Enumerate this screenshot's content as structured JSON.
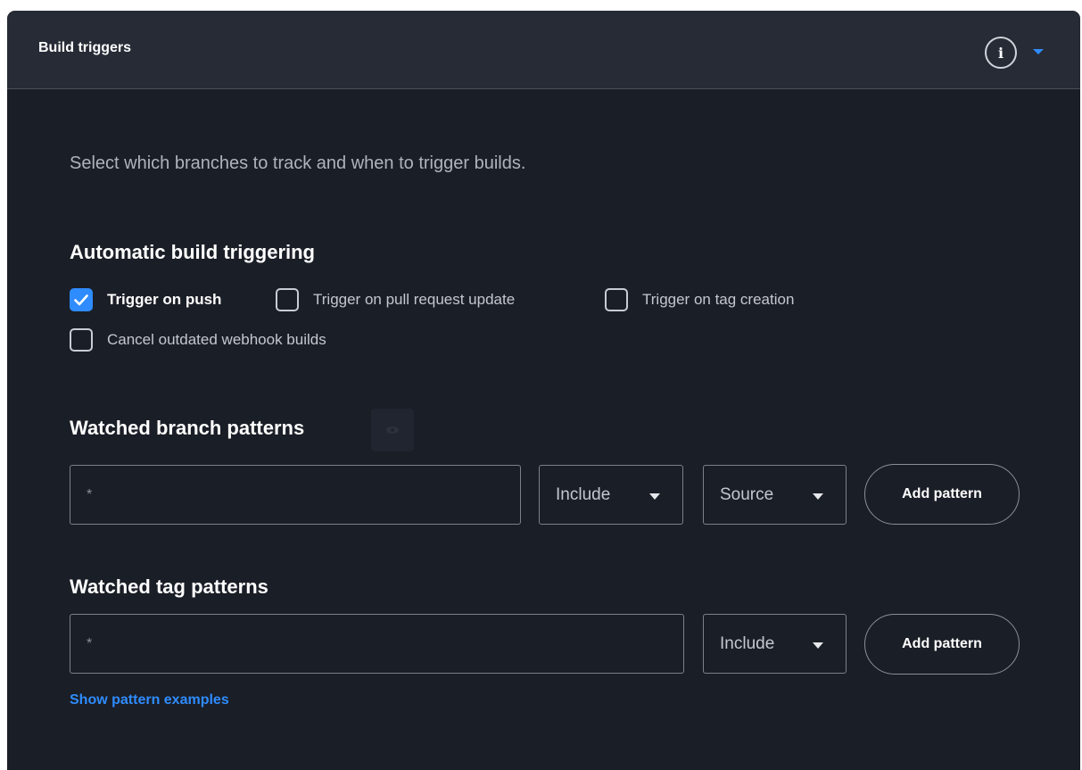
{
  "header": {
    "title": "Build triggers",
    "info_label": "i"
  },
  "intro": "Select which branches to track and when to trigger builds.",
  "automatic": {
    "title": "Automatic build triggering",
    "options": [
      {
        "label": "Trigger on push",
        "checked": true
      },
      {
        "label": "Trigger on pull request update",
        "checked": false
      },
      {
        "label": "Trigger on tag creation",
        "checked": false
      },
      {
        "label": "Cancel outdated webhook builds",
        "checked": false
      }
    ]
  },
  "branch_patterns": {
    "title": "Watched branch patterns",
    "input_placeholder": "*",
    "include_select": "Include",
    "source_select": "Source",
    "add_button": "Add pattern"
  },
  "tag_patterns": {
    "title": "Watched tag patterns",
    "input_placeholder": "*",
    "include_select": "Include",
    "add_button": "Add pattern"
  },
  "examples_link": "Show pattern examples",
  "colors": {
    "accent": "#2f8cff",
    "panel_bg": "#1a1e26",
    "header_bg": "#262b36"
  }
}
